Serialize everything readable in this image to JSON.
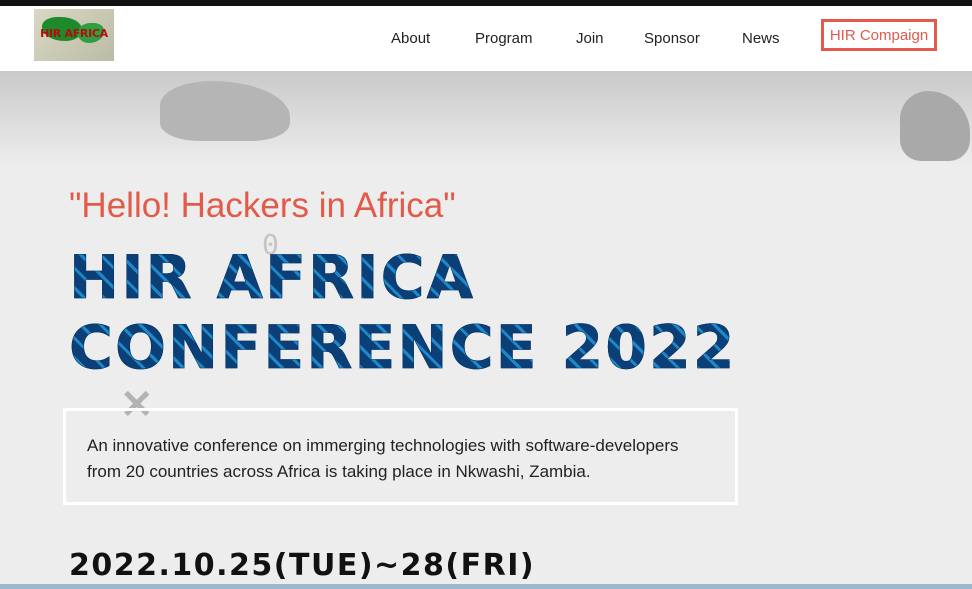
{
  "header": {
    "logo_alt": "HIR AFRICA",
    "nav": [
      "About",
      "Program",
      "Join",
      "Sponsor",
      "News"
    ],
    "cta": "HIR Compaign"
  },
  "hero": {
    "tagline": "\"Hello! Hackers in Africa\"",
    "title_line1": "HIR AFRICA",
    "title_line2": "CONFERENCE 2022",
    "description": "An innovative conference on immerging technologies with software-developers from 20 countries across Africa is taking place in Nkwashi, Zambia.",
    "date": "2022.10.25(TUE)~28(FRI)"
  },
  "colors": {
    "accent": "#e35a4c",
    "title_blue": "#0b4f8c"
  }
}
